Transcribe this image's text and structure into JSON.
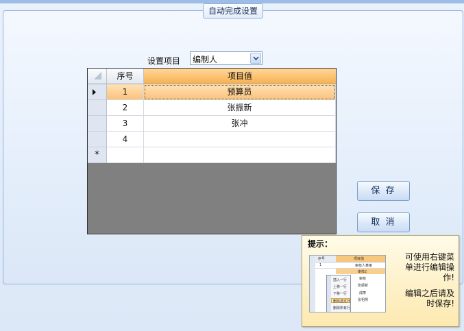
{
  "window": {
    "group_title": "自动完成设置"
  },
  "setting": {
    "label": "设置项目",
    "selected": "编制人"
  },
  "grid": {
    "columns": [
      "序号",
      "项目值"
    ],
    "rows": [
      {
        "seq": "1",
        "value": "预算员"
      },
      {
        "seq": "2",
        "value": "张振新"
      },
      {
        "seq": "3",
        "value": "张冲"
      },
      {
        "seq": "4",
        "value": ""
      }
    ],
    "new_row_marker": "*"
  },
  "buttons": {
    "save": "保 存",
    "cancel": "取 消"
  },
  "tip": {
    "title": "提示：",
    "line1": "可使用右键菜单进行编辑操作!",
    "line2": "编辑之后请及时保存!",
    "image": {
      "header_seq": "序号",
      "header_val": "项目值",
      "row1_seq": "1",
      "row1_val": "审核人某某",
      "row2_val": "审核2",
      "row3_val": "审核",
      "row4_val": "张振新",
      "row5_val": "成摩",
      "row6_val": "张祖樗",
      "menu_items": [
        "插入一行",
        "上移一行",
        "下移一行",
        "删除选定行",
        "删除所有行"
      ]
    }
  },
  "colors": {
    "header_accent": "#f7b04f",
    "current_row": "#fbc27b",
    "grid_empty": "#808080"
  }
}
